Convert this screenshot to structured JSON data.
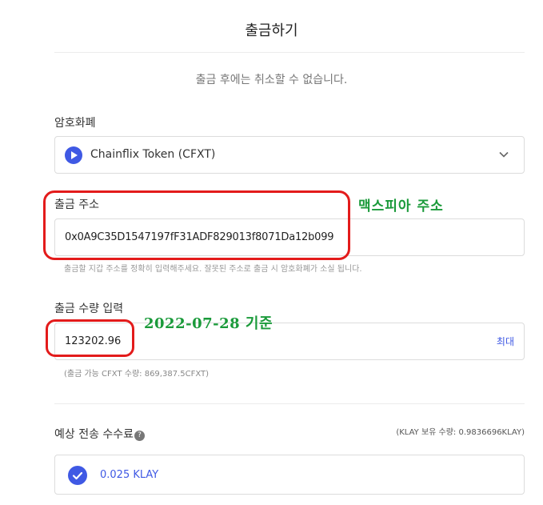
{
  "header": {
    "title": "출금하기",
    "warning": "출금 후에는 취소할 수 없습니다."
  },
  "currency": {
    "label": "암호화폐",
    "selected": "Chainflix Token (CFXT)",
    "icon": "play-icon",
    "accent_color": "#3f59e4"
  },
  "address": {
    "label": "출금 주소",
    "value": "0x0A9C35D1547197fF31ADF829013f8071Da12b099",
    "hint": "출금할 지갑 주소를 정확히 입력해주세요. 잘못된 주소로 출금 시 암호화폐가 소실 됩니다."
  },
  "amount": {
    "label": "출금 수량 입력",
    "value": "123202.96",
    "max_label": "최대",
    "available": "(출금 가능 CFXT 수량: 869,387.5CFXT)"
  },
  "fee": {
    "label": "예상 전송 수수료",
    "help_icon": "?",
    "klay_balance": "(KLAY 보유 수량: 0.9836696KLAY)",
    "value": "0.025 KLAY"
  },
  "annotations": {
    "address_note": "맥스피아  주소",
    "date_note": "2022-07-28  기준",
    "outline_color": "#e31b1b",
    "note_color": "#1a9a3a"
  }
}
